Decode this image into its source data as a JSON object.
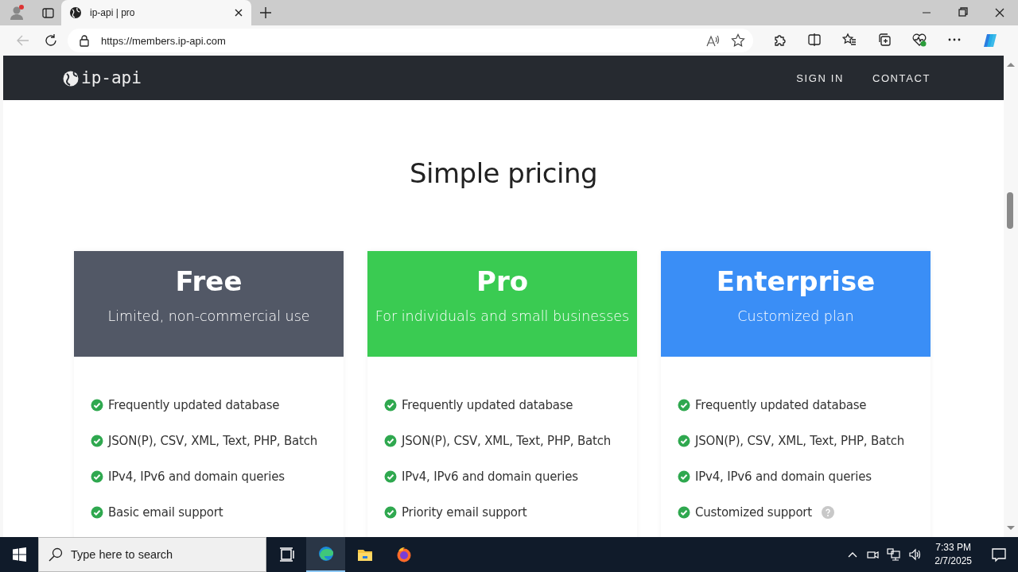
{
  "browser": {
    "tabs": [
      {
        "title": "ip-api | pro",
        "selected": true
      }
    ],
    "url": "https://members.ip-api.com"
  },
  "site": {
    "logo": "ip-api",
    "nav": [
      {
        "label": "SIGN IN"
      },
      {
        "label": "CONTACT"
      }
    ]
  },
  "heading": "Simple pricing",
  "plans": [
    {
      "name": "Free",
      "subtitle": "Limited, non-commercial use",
      "color": "#525866",
      "features": [
        {
          "text": "Frequently updated database",
          "help": false
        },
        {
          "text": "JSON(P), CSV, XML, Text, PHP, Batch",
          "help": false
        },
        {
          "text": "IPv4, IPv6 and domain queries",
          "help": false
        },
        {
          "text": "Basic email support",
          "help": false
        }
      ]
    },
    {
      "name": "Pro",
      "subtitle": "For individuals and small businesses",
      "color": "#3acb52",
      "features": [
        {
          "text": "Frequently updated database",
          "help": false
        },
        {
          "text": "JSON(P), CSV, XML, Text, PHP, Batch",
          "help": false
        },
        {
          "text": "IPv4, IPv6 and domain queries",
          "help": false
        },
        {
          "text": "Priority email support",
          "help": false
        }
      ]
    },
    {
      "name": "Enterprise",
      "subtitle": "Customized plan",
      "color": "#3a8ef6",
      "features": [
        {
          "text": "Frequently updated database",
          "help": false
        },
        {
          "text": "JSON(P), CSV, XML, Text, PHP, Batch",
          "help": false
        },
        {
          "text": "IPv4, IPv6 and domain queries",
          "help": false
        },
        {
          "text": "Customized support",
          "help": true
        }
      ]
    }
  ],
  "taskbar": {
    "search_placeholder": "Type here to search",
    "time": "7:33 PM",
    "date": "2/7/2025"
  }
}
